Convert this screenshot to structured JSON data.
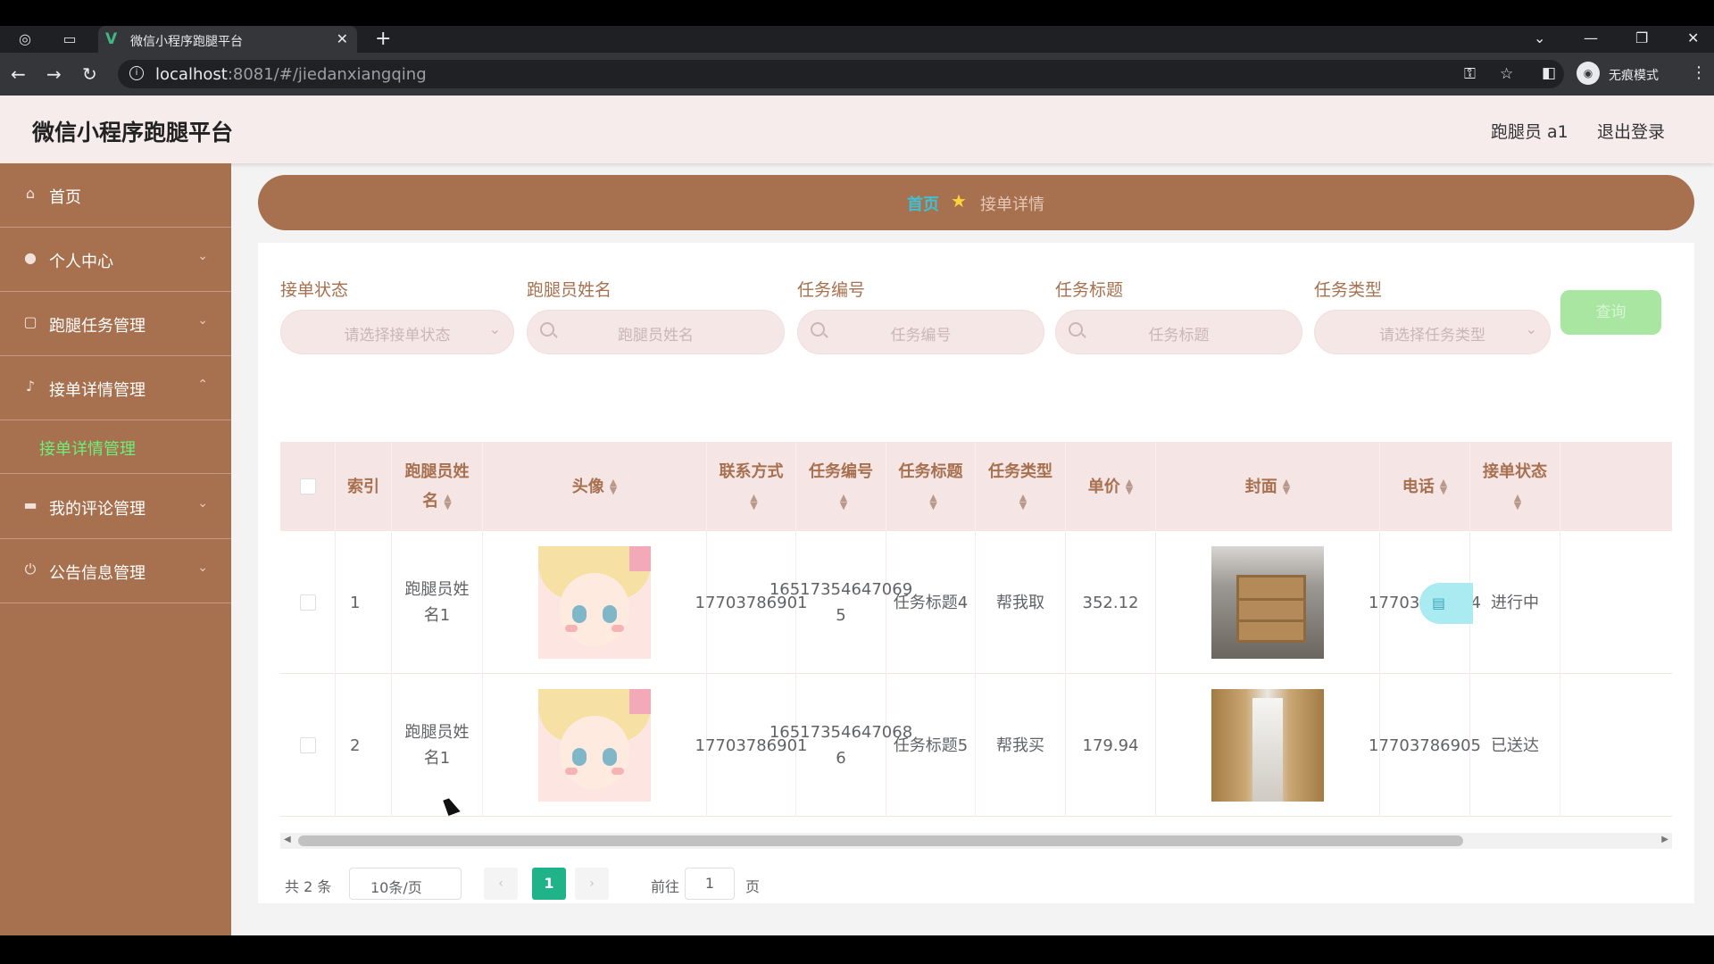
{
  "browser": {
    "tab_title": "微信小程序跑腿平台",
    "url_host": "localhost",
    "url_rest": ":8081/#/jiedanxiangqing",
    "incognito_label": "无痕模式"
  },
  "header": {
    "brand": "微信小程序跑腿平台",
    "user": "跑腿员 a1",
    "logout": "退出登录"
  },
  "sidebar": {
    "items": [
      {
        "label": "首页",
        "icon": "home-icon"
      },
      {
        "label": "个人中心",
        "icon": "user-icon"
      },
      {
        "label": "跑腿任务管理",
        "icon": "task-icon"
      },
      {
        "label": "接单详情管理",
        "icon": "mic-icon"
      },
      {
        "label": "我的评论管理",
        "icon": "comment-icon"
      },
      {
        "label": "公告信息管理",
        "icon": "power-icon"
      }
    ],
    "sub_active": "接单详情管理"
  },
  "breadcrumb": {
    "home": "首页",
    "current": "接单详情"
  },
  "filters": {
    "status_label": "接单状态",
    "status_placeholder": "请选择接单状态",
    "runner_label": "跑腿员姓名",
    "runner_placeholder": "跑腿员姓名",
    "task_no_label": "任务编号",
    "task_no_placeholder": "任务编号",
    "task_title_label": "任务标题",
    "task_title_placeholder": "任务标题",
    "task_type_label": "任务类型",
    "task_type_placeholder": "请选择任务类型",
    "search_button": "查询"
  },
  "table": {
    "headers": {
      "index": "索引",
      "runner": "跑腿员姓名",
      "avatar": "头像",
      "contact": "联系方式",
      "task_no": "任务编号",
      "task_title": "任务标题",
      "task_type": "任务类型",
      "price": "单价",
      "cover": "封面",
      "phone": "电话",
      "status": "接单状态"
    },
    "rows": [
      {
        "index": "1",
        "runner": "跑腿员姓名1",
        "contact": "17703786901",
        "task_no": "16517354647069 5",
        "task_title": "任务标题4",
        "task_type": "帮我取",
        "price": "352.12",
        "phone": "17703786904",
        "status": "进行中"
      },
      {
        "index": "2",
        "runner": "跑腿员姓名1",
        "contact": "17703786901",
        "task_no": "16517354647068 6",
        "task_title": "任务标题5",
        "task_type": "帮我买",
        "price": "179.94",
        "phone": "17703786905",
        "status": "已送达"
      }
    ]
  },
  "pagination": {
    "total": "共 2 条",
    "page_size": "10条/页",
    "current_page": "1",
    "goto_label": "前往",
    "goto_value": "1",
    "page_suffix": "页"
  }
}
